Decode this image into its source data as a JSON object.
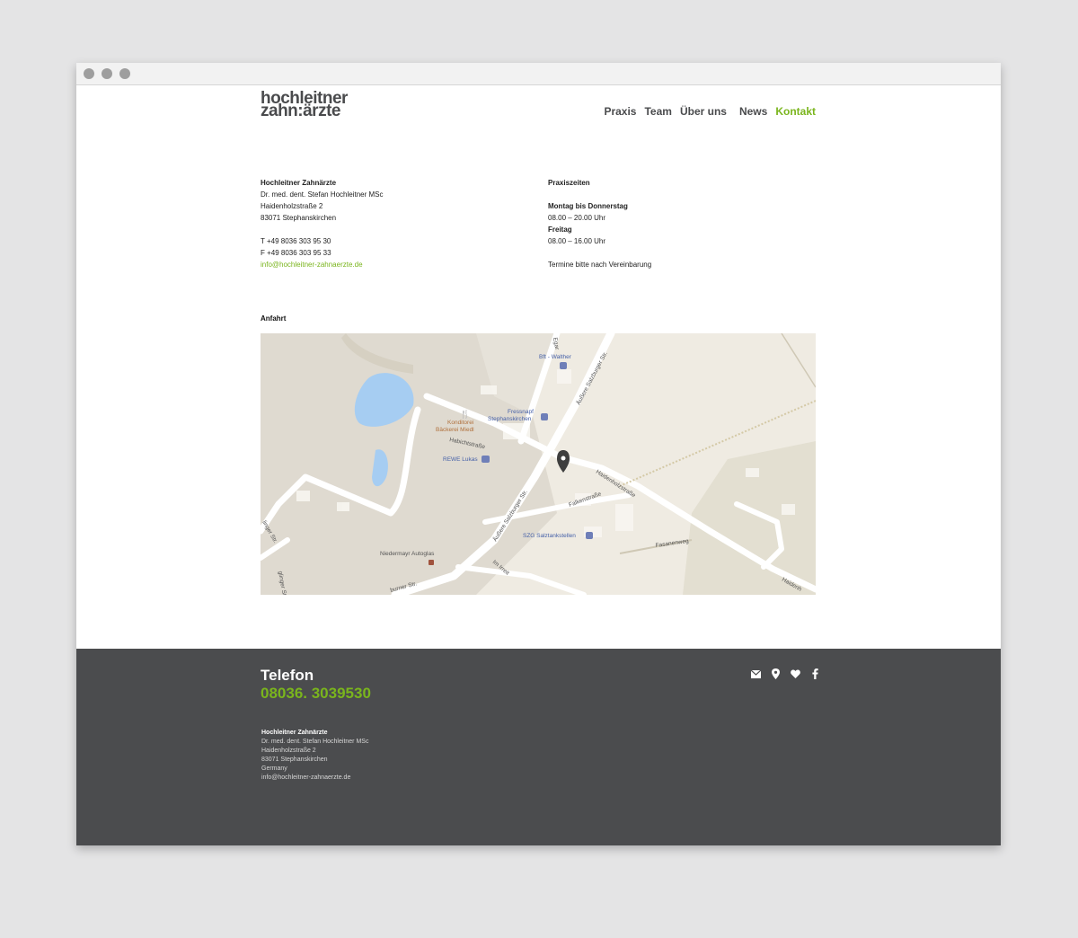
{
  "logo": {
    "line1": "hochleitner",
    "line2": "zahn:ärzte"
  },
  "nav": {
    "items": [
      {
        "label": "Praxis"
      },
      {
        "label": "Team"
      },
      {
        "label": "Über uns"
      },
      {
        "label": "News"
      },
      {
        "label": "Kontakt"
      }
    ]
  },
  "contact": {
    "name": "Hochleitner Zahnärzte",
    "doctor": "Dr. med. dent. Stefan Hochleitner MSc",
    "street": "Haidenholzstraße 2",
    "city": "83071 Stephanskirchen",
    "phone": "T +49 8036 303 95 30",
    "fax": "F +49 8036 303 95 33",
    "email": "info@hochleitner-zahnaerzte.de"
  },
  "hours": {
    "title": "Praxiszeiten",
    "days1": "Montag bis Donnerstag",
    "time1": "08.00 – 20.00 Uhr",
    "days2": "Freitag",
    "time2": "08.00 – 16.00 Uhr",
    "note": "Termine bitte nach Vereinbarung"
  },
  "directions": {
    "title": "Anfahrt",
    "map_labels": {
      "bft": "Bft - Walther",
      "fressnapf1": "Fressnapf",
      "fressnapf2": "Stephanskirchen",
      "konditorei1": "Konditorei",
      "konditorei2": "Bäckerei Miedl",
      "habichtstrasse": "Habichtstraße",
      "rewe": "REWE Lukas",
      "aussere1": "Äußere Salzburger Str.",
      "aussere2": "Äußere Salzburger Str.",
      "haidenholz": "Haidenholzstraße",
      "falken": "Falkenstraße",
      "szg": "SZG Salztankstellen",
      "fasanen": "Fasanenweg",
      "niedermayr": "Niedermayr Autoglas",
      "imirreit": "Im Irreit",
      "burner": "burner Str.",
      "linger": "linger Str.",
      "gglinger": "glinger Str.",
      "haidenh2": "Haidenh",
      "top": "Egar"
    }
  },
  "footer": {
    "tel_label": "Telefon",
    "tel_number": "08036. 3039530",
    "name": "Hochleitner Zahnärzte",
    "doctor": "Dr. med. dent. Stefan Hochleitner MSc",
    "street": "Haidenholzstraße 2",
    "city": "83071 Stephanskirchen",
    "country": "Germany",
    "email": "info@hochleitner-zahnaerzte.de"
  },
  "colors": {
    "accent": "#7ab51d",
    "footer_bg": "#4b4c4e",
    "text": "#4a4b4d"
  },
  "icons": [
    "mail-icon",
    "location-icon",
    "heart-icon",
    "facebook-icon"
  ]
}
